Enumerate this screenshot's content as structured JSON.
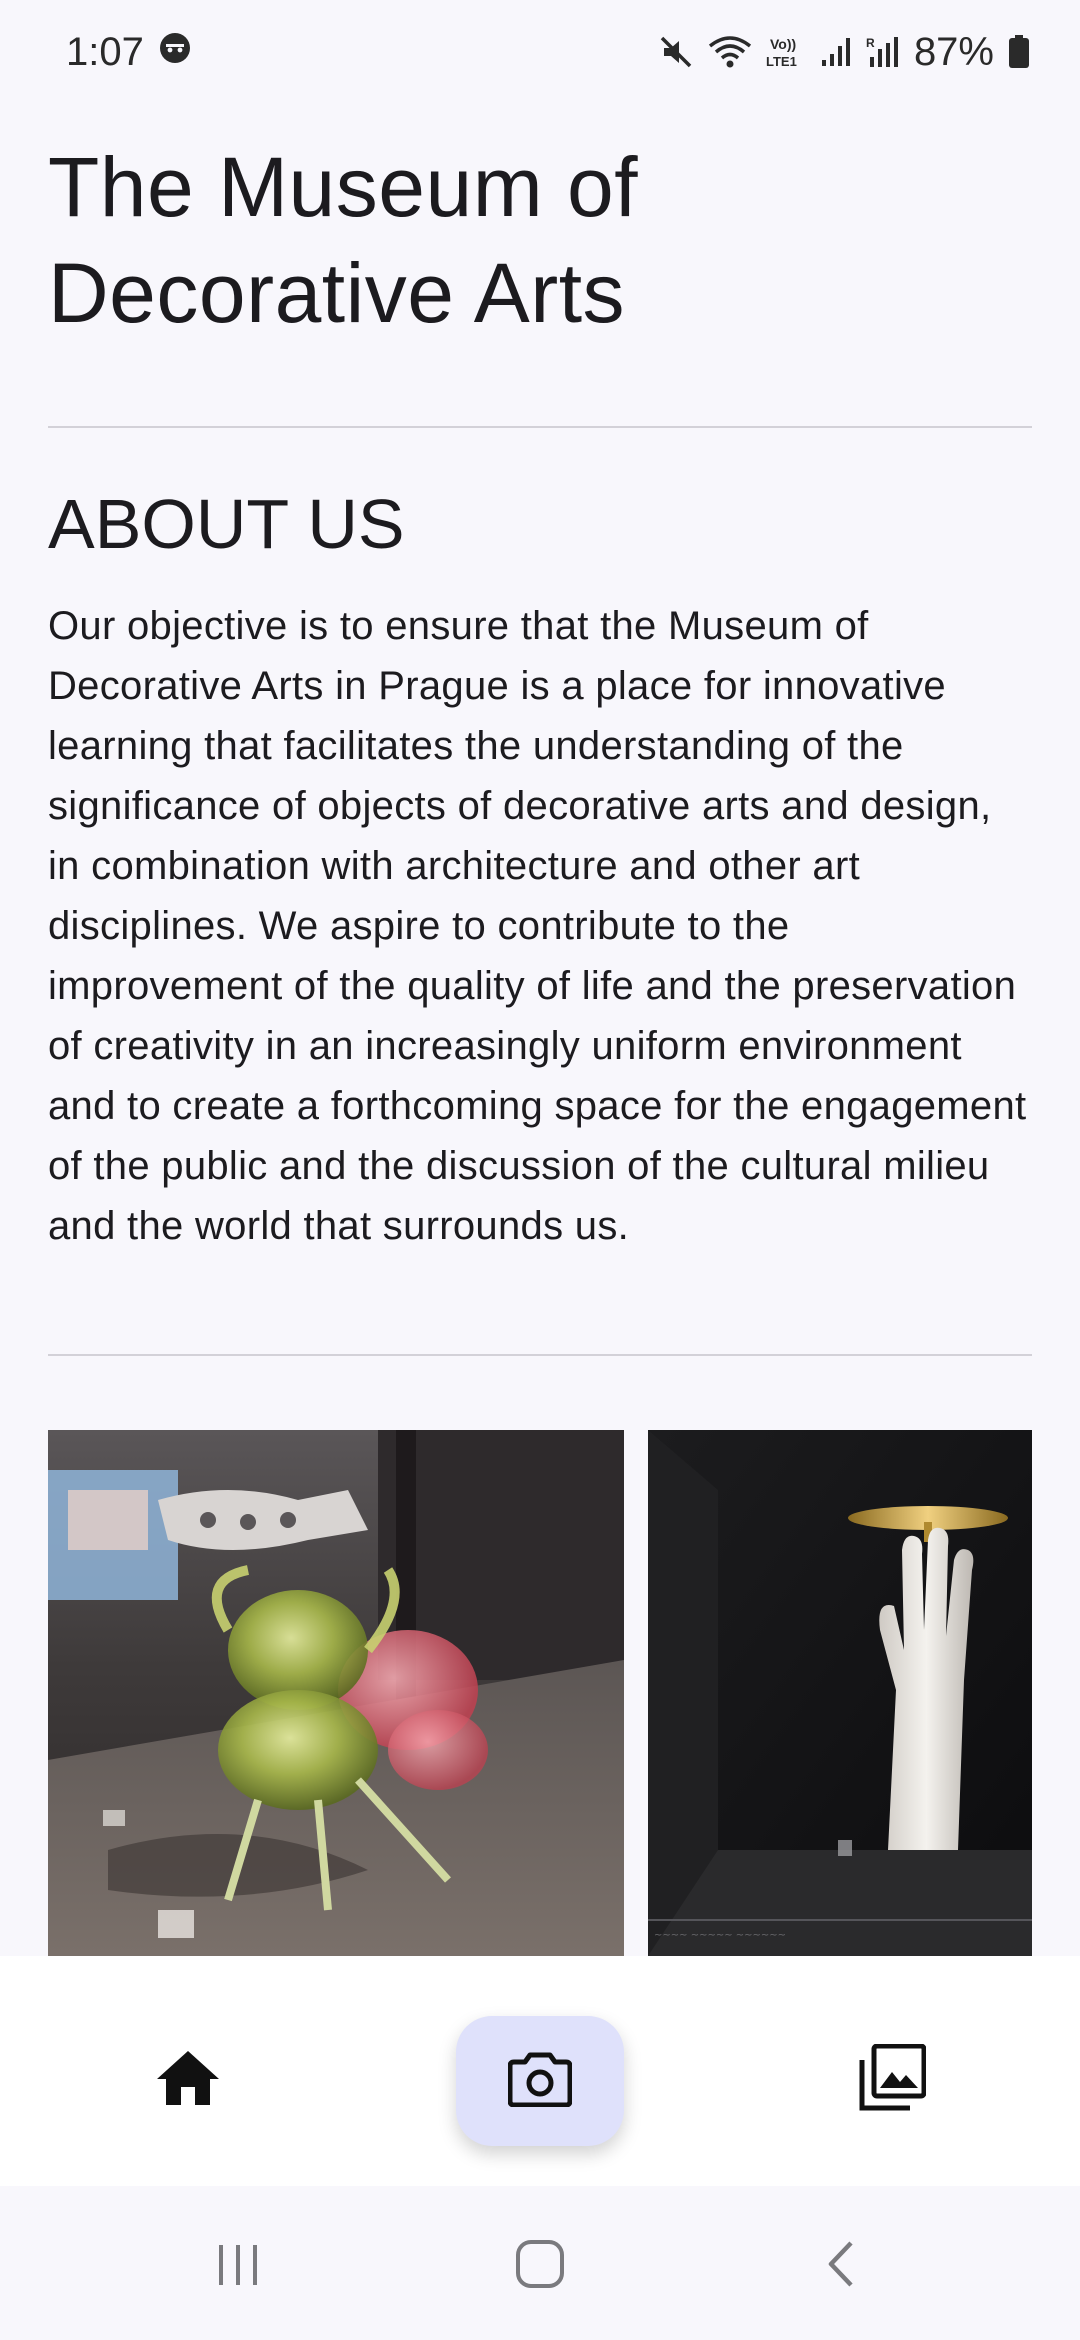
{
  "status_bar": {
    "time": "1:07",
    "battery": "87%",
    "icons": [
      "face-icon",
      "mute-icon",
      "wifi-icon",
      "volte-icon",
      "signal-icon",
      "signal-r-icon",
      "battery-icon"
    ]
  },
  "app": {
    "title": "The Museum of Decorative Arts"
  },
  "about": {
    "heading": "ABOUT US",
    "text": "Our objective is to ensure that the Museum of Decorative Arts in Prague is a place for innovative learning that facilitates the understanding of the significance of objects of decorative arts and design, in combination with architecture and other art disciplines. We aspire to contribute to the improvement of the quality of life and the preservation of creativity in an increasingly uniform environment and to create a forthcoming space for the engagement of the public and the discussion of the cultural milieu and the world that surrounds us."
  },
  "gallery": {
    "photos": [
      {
        "subject": "glass-sculpture-photo"
      },
      {
        "subject": "porcelain-hand-photo"
      }
    ]
  },
  "bottom_nav": {
    "items": [
      {
        "icon": "home-icon"
      },
      {
        "icon": "camera-icon",
        "selected": true
      },
      {
        "icon": "photo-library-icon"
      }
    ],
    "accent": "#dfe1fb"
  },
  "system_nav": {
    "icons": [
      "recents-icon",
      "home-circle-icon",
      "back-icon"
    ]
  }
}
